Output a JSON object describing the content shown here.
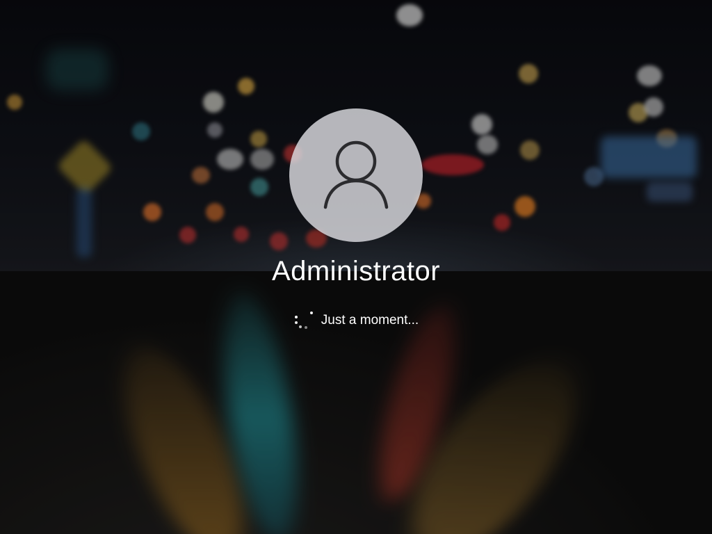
{
  "login": {
    "username": "Administrator",
    "status_text": "Just a moment..."
  },
  "icons": {
    "avatar": "user-icon",
    "spinner": "loading-spinner-icon"
  },
  "colors": {
    "text": "#ffffff",
    "avatar_background": "#dcdce1",
    "avatar_glyph": "#2b2b2e"
  }
}
